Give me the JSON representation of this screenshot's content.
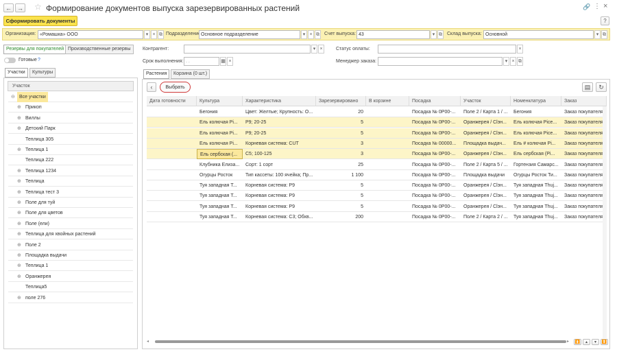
{
  "window": {
    "title": "Формирование документов выпуска зарезервированных растений"
  },
  "toolbar": {
    "create_docs": "Сформировать документы",
    "help": "?"
  },
  "filters": {
    "org_label": "Организация:",
    "org_value": "«Ромашка» ООО",
    "dept_label": "Подразделение:",
    "dept_value": "Основное подразделение",
    "invoice_label": "Счет выпуска:",
    "invoice_value": "43",
    "warehouse_label": "Склад выпуска:",
    "warehouse_value": "Основной"
  },
  "left": {
    "tab_customers": "Резервы для покупателей",
    "tab_production": "Производственные резервы",
    "toggle_label": "Готовые",
    "help_mark": "?",
    "tab_plots": "Участки",
    "tab_cultures": "Культуры",
    "tree_header": "Участок",
    "tree": [
      {
        "label": "Все участки",
        "exp": "⊖",
        "root": true
      },
      {
        "label": "Прикоп",
        "exp": "⊕"
      },
      {
        "label": "Виллы",
        "exp": "⊕"
      },
      {
        "label": "Детский Парк",
        "exp": "⊕"
      },
      {
        "label": "Теплица 305",
        "exp": ""
      },
      {
        "label": "Теплица 1",
        "exp": "⊕"
      },
      {
        "label": "Теплица 222",
        "exp": ""
      },
      {
        "label": "Теплица 1234",
        "exp": "⊕"
      },
      {
        "label": "Теплица",
        "exp": "⊕"
      },
      {
        "label": "Теплица  тест 3",
        "exp": "⊕"
      },
      {
        "label": "Поле для туй",
        "exp": "⊕"
      },
      {
        "label": "Поле для цветов",
        "exp": "⊕"
      },
      {
        "label": "Поле (ели)",
        "exp": "⊕"
      },
      {
        "label": "Теплица для хвойных растений",
        "exp": "⊕"
      },
      {
        "label": "Поле 2",
        "exp": "⊕"
      },
      {
        "label": "Площадка выдачи",
        "exp": "⊕"
      },
      {
        "label": "Теплица 1",
        "exp": "⊕"
      },
      {
        "label": "Оранжерея",
        "exp": "⊕"
      },
      {
        "label": "Теплица5",
        "exp": ""
      },
      {
        "label": "поле 276",
        "exp": "⊕"
      }
    ]
  },
  "right": {
    "contractor_label": "Контрагент:",
    "contractor_value": "",
    "pay_status_label": "Статус оплаты:",
    "pay_status_value": "",
    "deadline_label": "Срок выполнения:",
    "deadline_value": ". .",
    "manager_label": "Менеджер заказа:",
    "manager_value": "",
    "tab_plants": "Растения",
    "tab_cart": "Корзина (0 шт.)",
    "select_button": "Выбрать",
    "columns": [
      "Дата готовности",
      "Культура",
      "Характеристика",
      "Зарезервировано",
      "В корзине",
      "Посадка",
      "Участок",
      "Номенклатура",
      "Заказ"
    ],
    "rows": [
      {
        "date": "",
        "culture": "Бегония",
        "char": "Цвет: Желтые; Крупность: О...",
        "reserved": "20",
        "cart": "",
        "planting": "Посадка № 0Р00-...",
        "plot": "Поле 2 / Карта 1 / ...",
        "nom": "Бегония",
        "order": "Заказ покупателя ...",
        "hl": false
      },
      {
        "date": "",
        "culture": "Ель колючая Рі...",
        "char": "Р9; 20-25",
        "reserved": "5",
        "cart": "",
        "planting": "Посадка № 0Р00-...",
        "plot": "Оранжерея / Сlэн...",
        "nom": "Ель колючая Рісе...",
        "order": "Заказ покупателя ...",
        "hl": true
      },
      {
        "date": "",
        "culture": "Ель колючая Рі...",
        "char": "Р9; 20-25",
        "reserved": "5",
        "cart": "",
        "planting": "Посадка № 0Р00-...",
        "plot": "Оранжерея / Сlэн...",
        "nom": "Ель колючая Рісе...",
        "order": "Заказ покупателя ...",
        "hl": true
      },
      {
        "date": "",
        "culture": "Ель колючая Рі...",
        "char": "Корневая система: CUT",
        "reserved": "3",
        "cart": "",
        "planting": "Посадка № 00000...",
        "plot": "Площадка выдач...",
        "nom": "Ель # колючая Рі...",
        "order": "Заказ покупателя ...",
        "hl": true
      },
      {
        "date": "",
        "culture": "Ель сербская (...",
        "char": "С5; 100-125",
        "reserved": "3",
        "cart": "",
        "planting": "Посадка № 0Р00-...",
        "plot": "Оранжерея / Сlэн...",
        "nom": "Ель сербская (Рі...",
        "order": "Заказ покупателя ...",
        "hl": true,
        "cur": true
      },
      {
        "date": "",
        "culture": "Клубника Елиза...",
        "char": "Сорт: 1 сорт",
        "reserved": "25",
        "cart": "",
        "planting": "Посадка № 0Р00-...",
        "plot": "Поле 2 / Карта 5 / ...",
        "nom": "Гортензия Самарс...",
        "order": "Заказ покупателя ...",
        "hl": false
      },
      {
        "date": "",
        "culture": "Огурцы Росток",
        "char": "Тип кассеты: 100 ячейка; Пр...",
        "reserved": "1 100",
        "cart": "",
        "planting": "Посадка № 0Р00-...",
        "plot": "Площадка выдачи",
        "nom": "Огурцы Росток Ти...",
        "order": "Заказ покупателя ...",
        "hl": false
      },
      {
        "date": "",
        "culture": "Туя западная Т...",
        "char": "Корневая система: Р9",
        "reserved": "5",
        "cart": "",
        "planting": "Посадка № 0Р00-...",
        "plot": "Оранжерея / Сlэн...",
        "nom": "Туя западная Thuj...",
        "order": "Заказ покупателя ...",
        "hl": false
      },
      {
        "date": "",
        "culture": "Туя западная Т...",
        "char": "Корневая система: Р9",
        "reserved": "5",
        "cart": "",
        "planting": "Посадка № 0Р00-...",
        "plot": "Оранжерея / Сlэн...",
        "nom": "Туя западная Thuj...",
        "order": "Заказ покупателя ...",
        "hl": false
      },
      {
        "date": "",
        "culture": "Туя западная Т...",
        "char": "Корневая система: Р9",
        "reserved": "5",
        "cart": "",
        "planting": "Посадка № 0Р00-...",
        "plot": "Оранжерея / Сlэн...",
        "nom": "Туя западная Thuj...",
        "order": "Заказ покупателя ...",
        "hl": false
      },
      {
        "date": "",
        "culture": "Туя западная Т...",
        "char": "Корневая система: С3; Обхв...",
        "reserved": "200",
        "cart": "",
        "planting": "Посадка № 0Р00-...",
        "plot": "Поле 2 / Карта 2 / ...",
        "nom": "Туя западная Thuj...",
        "order": "Заказ покупателя ...",
        "hl": false
      }
    ]
  },
  "colors": {
    "accent_yellow": "#fbe34c",
    "highlight_row": "#fdf5c8",
    "active_tab": "#2b8a2b",
    "select_ring": "#d03a3a"
  }
}
